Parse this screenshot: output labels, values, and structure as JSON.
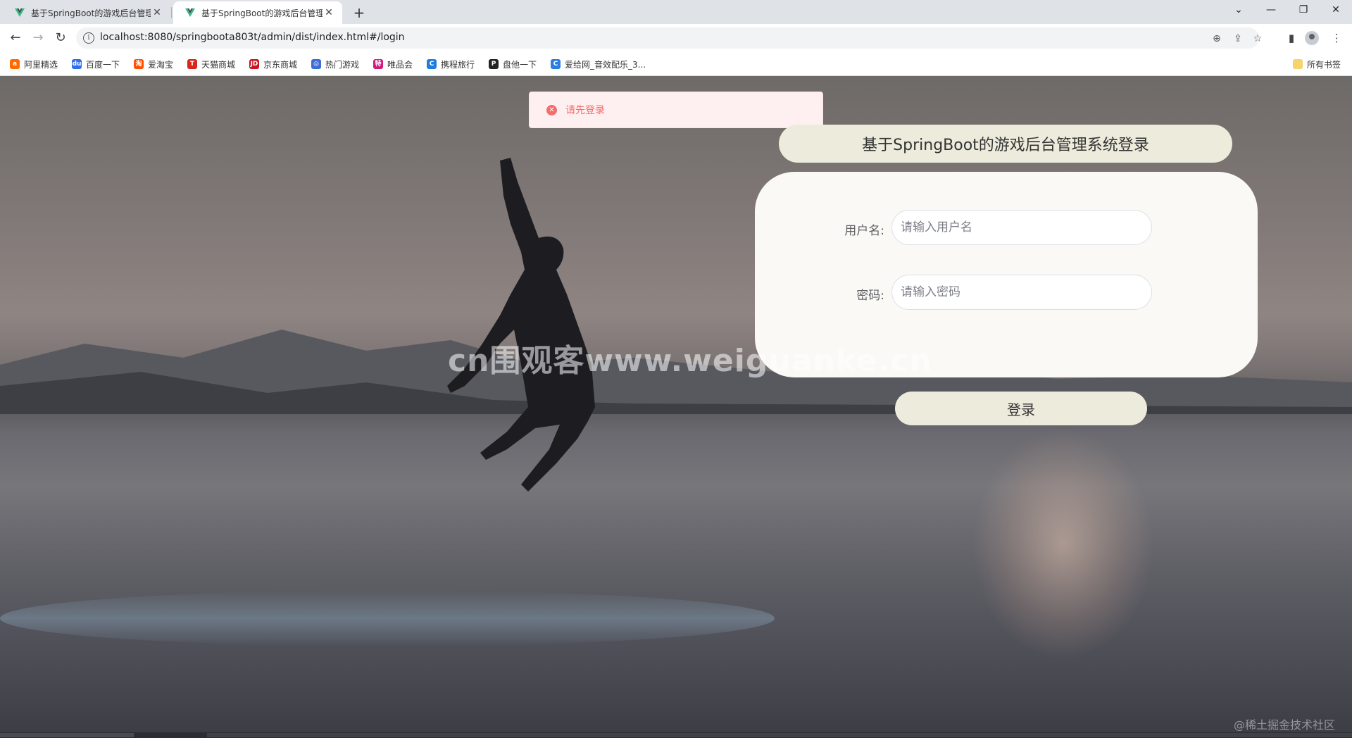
{
  "browser": {
    "tabs": [
      {
        "title": "基于SpringBoot的游戏后台管理",
        "active": false
      },
      {
        "title": "基于SpringBoot的游戏后台管理",
        "active": true
      }
    ],
    "url": "localhost:8080/springboota803t/admin/dist/index.html#/login",
    "bookmarks": [
      {
        "label": "阿里精选",
        "color": "#ff6a00"
      },
      {
        "label": "百度一下",
        "color": "#2f6ee8"
      },
      {
        "label": "爱淘宝",
        "color": "#ff5000"
      },
      {
        "label": "天猫商城",
        "color": "#d8261b"
      },
      {
        "label": "京东商城",
        "color": "#c81623"
      },
      {
        "label": "热门游戏",
        "color": "#3b6bd6"
      },
      {
        "label": "唯品会",
        "color": "#d01a7e"
      },
      {
        "label": "携程旅行",
        "color": "#1f7de0"
      },
      {
        "label": "盘他一下",
        "color": "#222222"
      },
      {
        "label": "爱给网_音效配乐_3...",
        "color": "#2a7de1"
      }
    ],
    "bookmarks_folder": "所有书签"
  },
  "toast": {
    "type": "error",
    "message": "请先登录"
  },
  "login": {
    "title": "基于SpringBoot的游戏后台管理系统登录",
    "username_label": "用户名:",
    "username_placeholder": "请输入用户名",
    "password_label": "密码:",
    "password_placeholder": "请输入密码",
    "submit_label": "登录"
  },
  "watermark": "cn围观客www.weiguanke.cn",
  "corner_watermark": "@稀土掘金技术社区",
  "colors": {
    "pill_bg": "#ecebdc",
    "card_bg": "#faf9f6",
    "error": "#f56c6c"
  }
}
